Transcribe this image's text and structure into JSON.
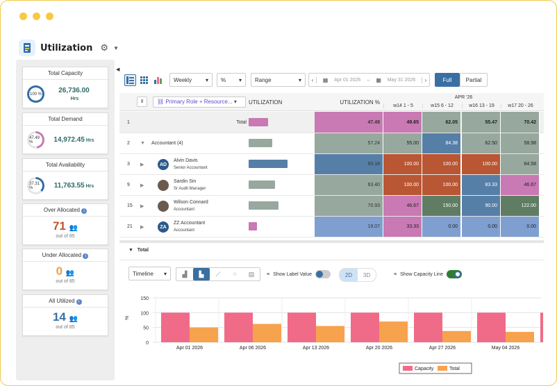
{
  "app": {
    "title": "Utilization"
  },
  "sidebar": {
    "total_capacity": {
      "title": "Total Capacity",
      "pct": "100 %",
      "value": "26,736.00",
      "unit": "Hrs"
    },
    "total_demand": {
      "title": "Total Demand",
      "pct": "47.49 %",
      "value": "14,972.45",
      "unit": "Hrs"
    },
    "total_availability": {
      "title": "Total Availability",
      "pct": "37.31 %",
      "value": "11,763.55",
      "unit": "Hrs"
    },
    "over_allocated": {
      "title": "Over Allocated",
      "count": "71",
      "out_of": "out of 85"
    },
    "under_allocated": {
      "title": "Under Allocated",
      "count": "0",
      "out_of": "out of 85"
    },
    "all_utilized": {
      "title": "All Utilized",
      "count": "14",
      "out_of": "out of 85"
    }
  },
  "toolbar": {
    "period": "Weekly",
    "unit": "%",
    "range": "Range",
    "date_from": "Apr 01 2026",
    "date_to": "May 31 2026",
    "full": "Full",
    "partial": "Partial"
  },
  "grid": {
    "group_by": "Primary Role + Resource...",
    "col_utilization": "UTILIZATION",
    "col_utilization_pct": "UTILIZATION %",
    "month": "APR '26",
    "weeks": [
      "w14 1 - 5",
      "w15 6 - 12",
      "w16 13 - 19",
      "w17 20 - 26"
    ],
    "rows": [
      {
        "num": "1",
        "label": "Total",
        "role": "",
        "initials": "",
        "pct": "47.49",
        "weeks": [
          "49.65",
          "62.05",
          "55.47",
          "70.42"
        ],
        "bar_fraction": 0.47,
        "bar_color": "#c979b3"
      },
      {
        "num": "2",
        "label": "Accountant (4)",
        "role": "",
        "initials": "",
        "pct": "57.24",
        "weeks": [
          "55.00",
          "84.38",
          "62.50",
          "58.98"
        ],
        "bar_fraction": 0.57,
        "bar_color": "#97a89e"
      },
      {
        "num": "3",
        "label": "Alvin Davis",
        "role": "Senior Accountant",
        "initials": "AD",
        "pct": "93.18",
        "weeks": [
          "100.00",
          "100.00",
          "100.00",
          "64.58"
        ],
        "bar_fraction": 0.93,
        "bar_color": "#567fa7"
      },
      {
        "num": "9",
        "label": "Sardin Sin",
        "role": "Sr Audit Manager",
        "initials": "",
        "pct": "63.40",
        "weeks": [
          "100.00",
          "100.00",
          "83.33",
          "46.67"
        ],
        "bar_fraction": 0.63,
        "bar_color": "#97a89e"
      },
      {
        "num": "15",
        "label": "Wilson Connard",
        "role": "Accountant",
        "initials": "",
        "pct": "70.93",
        "weeks": [
          "46.67",
          "150.00",
          "90.00",
          "122.00"
        ],
        "bar_fraction": 0.71,
        "bar_color": "#97a89e"
      },
      {
        "num": "21",
        "label": "ZZ Accountant",
        "role": "Accountant",
        "initials": "ZA",
        "pct": "19.07",
        "weeks": [
          "33.33",
          "0.00",
          "0.00",
          "0.00"
        ],
        "bar_fraction": 0.19,
        "bar_color": "#c979b3"
      }
    ]
  },
  "colors": {
    "pink": "#c979b3",
    "sage": "#97a89e",
    "blue": "#567fa7",
    "rust": "#b95634",
    "green": "#607d63",
    "lightblue": "#7f9fd0",
    "accent": "#3a6fa3"
  },
  "bottom": {
    "section": "Total",
    "view": "Timeline",
    "show_label_value": "Show Label Value",
    "d2": "2D",
    "d3": "3D",
    "show_capacity": "Show Capacity Line"
  },
  "chart_data": {
    "type": "bar",
    "categories": [
      "Apr 01 2026",
      "Apr 06 2026",
      "Apr 13 2026",
      "Apr 20 2026",
      "Apr 27 2026",
      "May 04 2026"
    ],
    "series": [
      {
        "name": "Capacity",
        "values": [
          100,
          100,
          100,
          100,
          100,
          100
        ],
        "color": "#f06b88"
      },
      {
        "name": "Total",
        "values": [
          50,
          62,
          55,
          70,
          38,
          35
        ],
        "color": "#f7a24d"
      }
    ],
    "ylabel": "%",
    "yticks": [
      "150",
      "100",
      "50",
      "0"
    ],
    "ylim": [
      0,
      150
    ],
    "grid": true,
    "legend": "bottom-right"
  }
}
